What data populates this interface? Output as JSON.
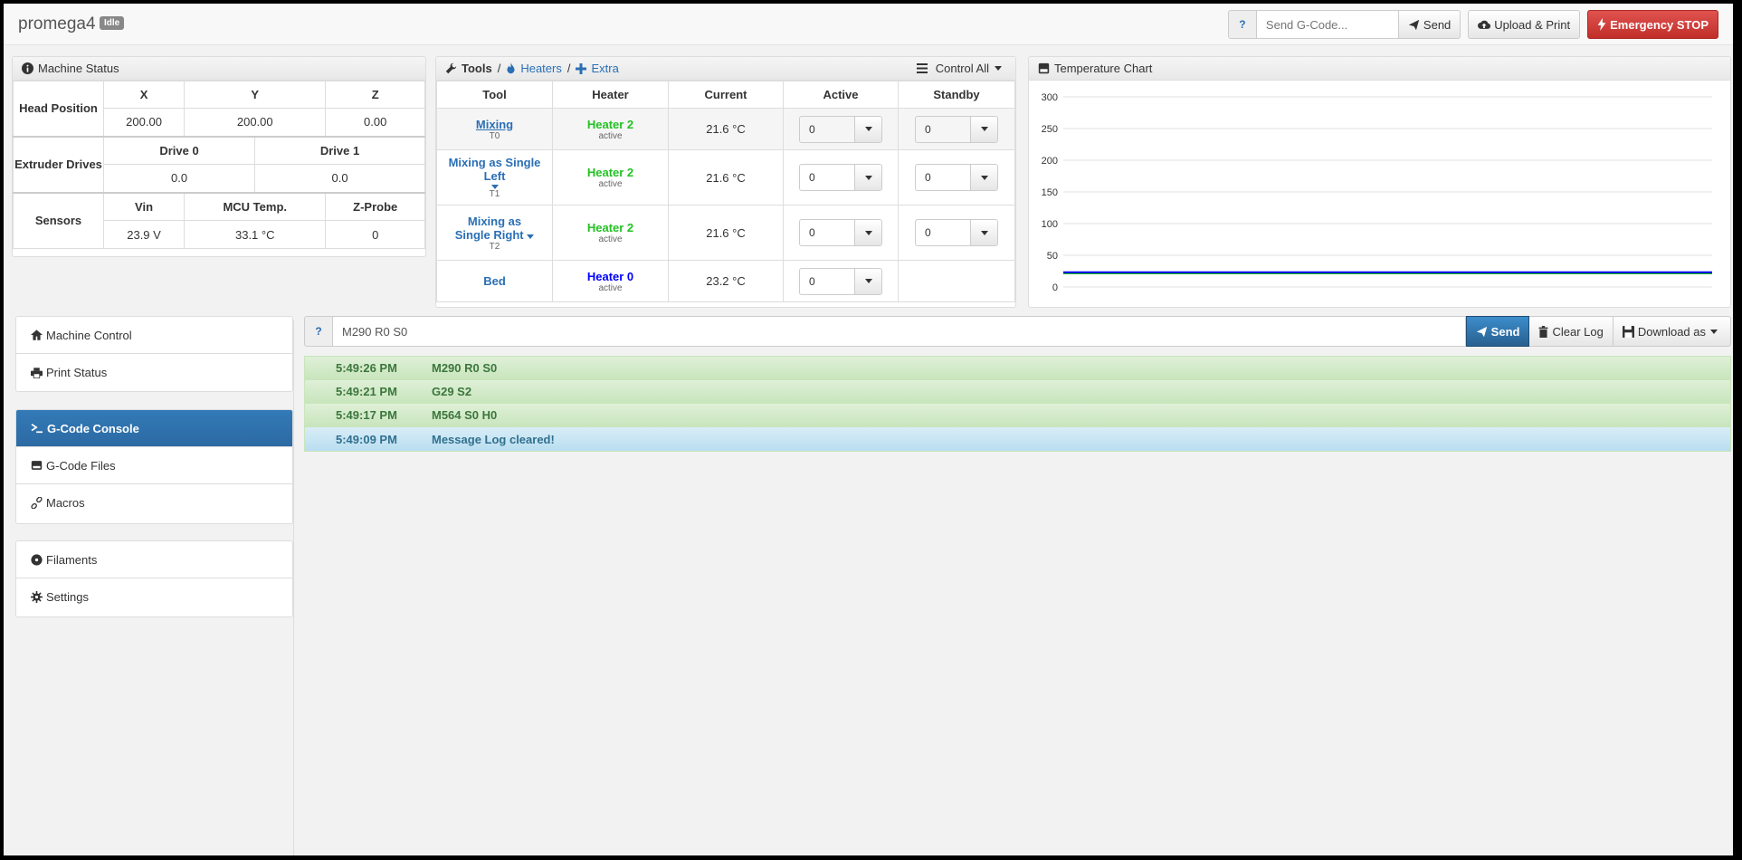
{
  "navbar": {
    "brand": "promega4",
    "status_badge": "Idle",
    "help_label": "?",
    "gcode_placeholder": "Send G-Code...",
    "send_label": "Send",
    "upload_print_label": "Upload & Print",
    "emergency_label": "Emergency STOP"
  },
  "machine_status": {
    "title": "Machine Status",
    "head_position": {
      "label": "Head Position",
      "headers": [
        "X",
        "Y",
        "Z"
      ],
      "values": [
        "200.00",
        "200.00",
        "0.00"
      ]
    },
    "extruder_drives": {
      "label": "Extruder Drives",
      "headers": [
        "Drive 0",
        "Drive 1"
      ],
      "values": [
        "0.0",
        "0.0"
      ]
    },
    "sensors": {
      "label": "Sensors",
      "headers": [
        "Vin",
        "MCU Temp.",
        "Z-Probe"
      ],
      "values": [
        "23.9 V",
        "33.1 °C",
        "0"
      ]
    }
  },
  "tools": {
    "title": "Tools",
    "sep": "/",
    "heaters_link": "Heaters",
    "extra_link": "Extra",
    "control_all": "Control All",
    "headers": [
      "Tool",
      "Heater",
      "Current",
      "Active",
      "Standby"
    ],
    "rows": [
      {
        "name": "Mixing",
        "sub": "T0",
        "heater": "Heater 2",
        "state": "active",
        "current": "21.6 °C",
        "active": "0",
        "standby": "0"
      },
      {
        "name": "Mixing as Single Left",
        "sub": "T1",
        "heater": "Heater 2",
        "state": "active",
        "current": "21.6 °C",
        "active": "0",
        "standby": "0"
      },
      {
        "name": "Mixing as Single Right",
        "sub": "T2",
        "heater": "Heater 2",
        "state": "active",
        "current": "21.6 °C",
        "active": "0",
        "standby": "0"
      },
      {
        "name": "Bed",
        "sub": "",
        "heater": "Heater 0",
        "state": "active",
        "current": "23.2 °C",
        "active": "0",
        "standby": ""
      }
    ]
  },
  "temperature_chart": {
    "title": "Temperature Chart"
  },
  "chart_data": {
    "type": "line",
    "title": "Temperature Chart",
    "xlabel": "",
    "ylabel": "",
    "ylim": [
      0,
      300
    ],
    "yticks": [
      "300",
      "250",
      "200",
      "150",
      "100",
      "50",
      "0"
    ],
    "grid": true,
    "series": [
      {
        "color": "#00aa00",
        "values": [
          21.6,
          21.6,
          21.6,
          21.6,
          21.6,
          21.6,
          21.6,
          21.6,
          21.6,
          21.6
        ]
      },
      {
        "color": "#0000ff",
        "values": [
          23.2,
          23.2,
          23.2,
          23.2,
          23.2,
          23.2,
          23.2,
          23.2,
          23.2,
          23.2
        ]
      }
    ]
  },
  "sidebar": {
    "group1": [
      "Machine Control",
      "Print Status"
    ],
    "group2": [
      "G-Code Console",
      "G-Code Files",
      "Macros"
    ],
    "group3": [
      "Filaments",
      "Settings"
    ]
  },
  "console": {
    "help_label": "?",
    "input_value": "M290 R0 S0",
    "send_label": "Send",
    "clear_label": "Clear Log",
    "download_label": "Download as",
    "log": [
      {
        "time": "5:49:26 PM",
        "msg": "M290 R0 S0",
        "type": "success"
      },
      {
        "time": "5:49:21 PM",
        "msg": "G29 S2",
        "type": "success"
      },
      {
        "time": "5:49:17 PM",
        "msg": "M564 S0 H0",
        "type": "success"
      },
      {
        "time": "5:49:09 PM",
        "msg": "Message Log cleared!",
        "type": "info"
      }
    ]
  }
}
